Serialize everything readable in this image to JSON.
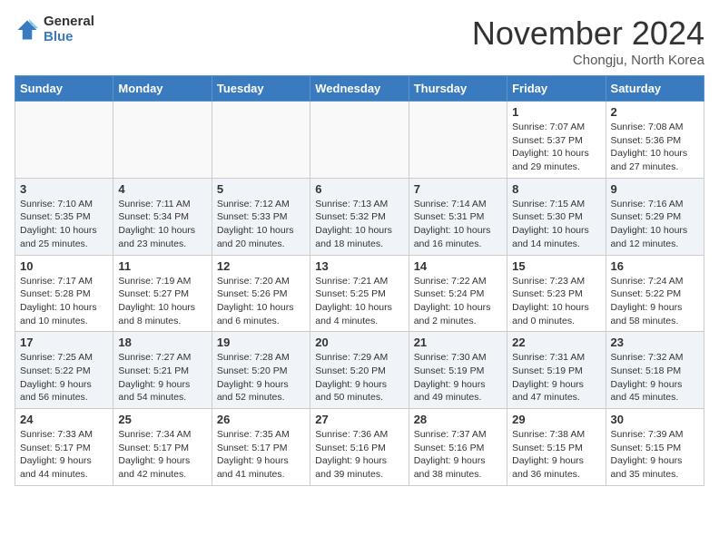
{
  "header": {
    "logo_general": "General",
    "logo_blue": "Blue",
    "month_title": "November 2024",
    "subtitle": "Chongju, North Korea"
  },
  "weekdays": [
    "Sunday",
    "Monday",
    "Tuesday",
    "Wednesday",
    "Thursday",
    "Friday",
    "Saturday"
  ],
  "weeks": [
    [
      {
        "day": "",
        "info": ""
      },
      {
        "day": "",
        "info": ""
      },
      {
        "day": "",
        "info": ""
      },
      {
        "day": "",
        "info": ""
      },
      {
        "day": "",
        "info": ""
      },
      {
        "day": "1",
        "info": "Sunrise: 7:07 AM\nSunset: 5:37 PM\nDaylight: 10 hours and 29 minutes."
      },
      {
        "day": "2",
        "info": "Sunrise: 7:08 AM\nSunset: 5:36 PM\nDaylight: 10 hours and 27 minutes."
      }
    ],
    [
      {
        "day": "3",
        "info": "Sunrise: 7:10 AM\nSunset: 5:35 PM\nDaylight: 10 hours and 25 minutes."
      },
      {
        "day": "4",
        "info": "Sunrise: 7:11 AM\nSunset: 5:34 PM\nDaylight: 10 hours and 23 minutes."
      },
      {
        "day": "5",
        "info": "Sunrise: 7:12 AM\nSunset: 5:33 PM\nDaylight: 10 hours and 20 minutes."
      },
      {
        "day": "6",
        "info": "Sunrise: 7:13 AM\nSunset: 5:32 PM\nDaylight: 10 hours and 18 minutes."
      },
      {
        "day": "7",
        "info": "Sunrise: 7:14 AM\nSunset: 5:31 PM\nDaylight: 10 hours and 16 minutes."
      },
      {
        "day": "8",
        "info": "Sunrise: 7:15 AM\nSunset: 5:30 PM\nDaylight: 10 hours and 14 minutes."
      },
      {
        "day": "9",
        "info": "Sunrise: 7:16 AM\nSunset: 5:29 PM\nDaylight: 10 hours and 12 minutes."
      }
    ],
    [
      {
        "day": "10",
        "info": "Sunrise: 7:17 AM\nSunset: 5:28 PM\nDaylight: 10 hours and 10 minutes."
      },
      {
        "day": "11",
        "info": "Sunrise: 7:19 AM\nSunset: 5:27 PM\nDaylight: 10 hours and 8 minutes."
      },
      {
        "day": "12",
        "info": "Sunrise: 7:20 AM\nSunset: 5:26 PM\nDaylight: 10 hours and 6 minutes."
      },
      {
        "day": "13",
        "info": "Sunrise: 7:21 AM\nSunset: 5:25 PM\nDaylight: 10 hours and 4 minutes."
      },
      {
        "day": "14",
        "info": "Sunrise: 7:22 AM\nSunset: 5:24 PM\nDaylight: 10 hours and 2 minutes."
      },
      {
        "day": "15",
        "info": "Sunrise: 7:23 AM\nSunset: 5:23 PM\nDaylight: 10 hours and 0 minutes."
      },
      {
        "day": "16",
        "info": "Sunrise: 7:24 AM\nSunset: 5:22 PM\nDaylight: 9 hours and 58 minutes."
      }
    ],
    [
      {
        "day": "17",
        "info": "Sunrise: 7:25 AM\nSunset: 5:22 PM\nDaylight: 9 hours and 56 minutes."
      },
      {
        "day": "18",
        "info": "Sunrise: 7:27 AM\nSunset: 5:21 PM\nDaylight: 9 hours and 54 minutes."
      },
      {
        "day": "19",
        "info": "Sunrise: 7:28 AM\nSunset: 5:20 PM\nDaylight: 9 hours and 52 minutes."
      },
      {
        "day": "20",
        "info": "Sunrise: 7:29 AM\nSunset: 5:20 PM\nDaylight: 9 hours and 50 minutes."
      },
      {
        "day": "21",
        "info": "Sunrise: 7:30 AM\nSunset: 5:19 PM\nDaylight: 9 hours and 49 minutes."
      },
      {
        "day": "22",
        "info": "Sunrise: 7:31 AM\nSunset: 5:19 PM\nDaylight: 9 hours and 47 minutes."
      },
      {
        "day": "23",
        "info": "Sunrise: 7:32 AM\nSunset: 5:18 PM\nDaylight: 9 hours and 45 minutes."
      }
    ],
    [
      {
        "day": "24",
        "info": "Sunrise: 7:33 AM\nSunset: 5:17 PM\nDaylight: 9 hours and 44 minutes."
      },
      {
        "day": "25",
        "info": "Sunrise: 7:34 AM\nSunset: 5:17 PM\nDaylight: 9 hours and 42 minutes."
      },
      {
        "day": "26",
        "info": "Sunrise: 7:35 AM\nSunset: 5:17 PM\nDaylight: 9 hours and 41 minutes."
      },
      {
        "day": "27",
        "info": "Sunrise: 7:36 AM\nSunset: 5:16 PM\nDaylight: 9 hours and 39 minutes."
      },
      {
        "day": "28",
        "info": "Sunrise: 7:37 AM\nSunset: 5:16 PM\nDaylight: 9 hours and 38 minutes."
      },
      {
        "day": "29",
        "info": "Sunrise: 7:38 AM\nSunset: 5:15 PM\nDaylight: 9 hours and 36 minutes."
      },
      {
        "day": "30",
        "info": "Sunrise: 7:39 AM\nSunset: 5:15 PM\nDaylight: 9 hours and 35 minutes."
      }
    ]
  ]
}
